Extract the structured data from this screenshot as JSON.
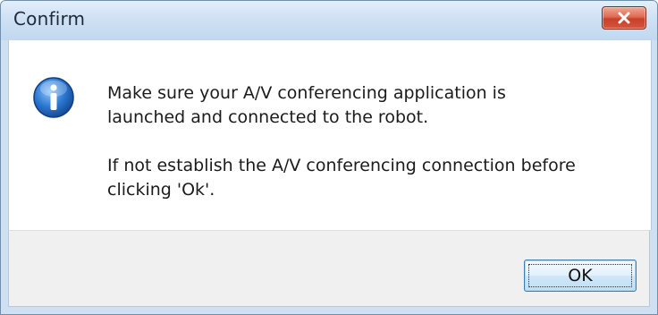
{
  "window": {
    "title": "Confirm"
  },
  "title_bar": {
    "close_icon": "close-icon"
  },
  "dialog": {
    "icon": "info-icon",
    "message_paragraph_1": "Make sure your A/V conferencing application is\nlaunched and connected to the robot.",
    "message_paragraph_2": "If not establish the A/V conferencing connection before\nclicking 'Ok'."
  },
  "buttons": {
    "ok_label": "OK"
  },
  "colors": {
    "title_bar": "#cfe1f4",
    "close_button": "#d7553c",
    "info_icon": "#1f63b8",
    "footer": "#f0f0f0"
  }
}
